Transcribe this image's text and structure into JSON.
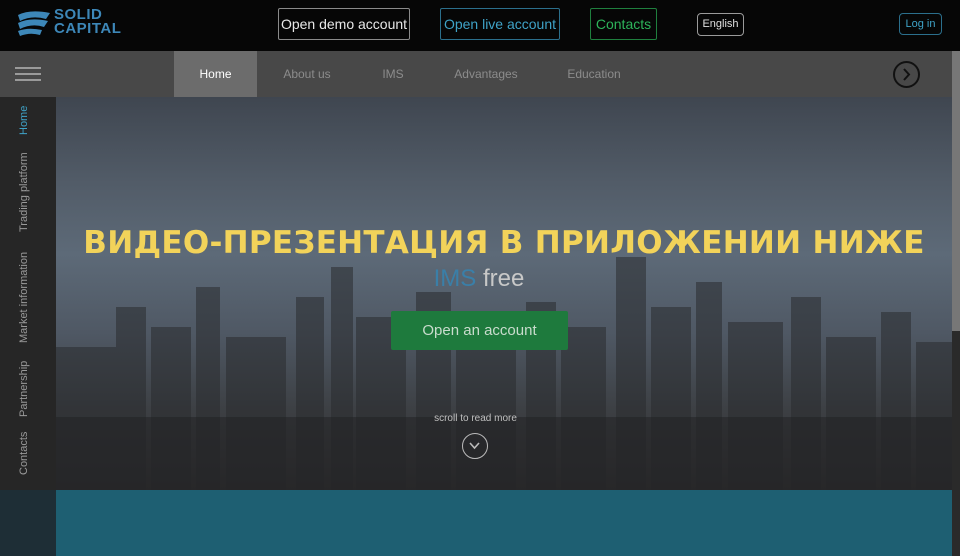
{
  "header": {
    "logo_line1": "SOLID",
    "logo_line2": "CAPITAL",
    "open_demo": "Open demo account",
    "open_live": "Open live account",
    "contacts": "Contacts",
    "language": "English",
    "login": "Log in"
  },
  "nav": {
    "items": [
      "Home",
      "About us",
      "IMS",
      "Advantages",
      "Education"
    ],
    "active": "Home"
  },
  "sidenav": {
    "items": [
      "Home",
      "Trading platform",
      "Market information",
      "Partnership",
      "Contacts"
    ]
  },
  "hero": {
    "product_a": "IMS",
    "product_b": "free",
    "cta": "Open an account",
    "scroll": "scroll to read more"
  },
  "overlay_title": "ВИДЕО-ПРЕЗЕНТАЦИЯ В ПРИЛОЖЕНИИ НИЖЕ",
  "colors": {
    "accent_blue": "#3fa3c8",
    "accent_green": "#1e7a3d",
    "overlay_yellow": "#f2d35a",
    "teal_section": "#1e5f72"
  }
}
